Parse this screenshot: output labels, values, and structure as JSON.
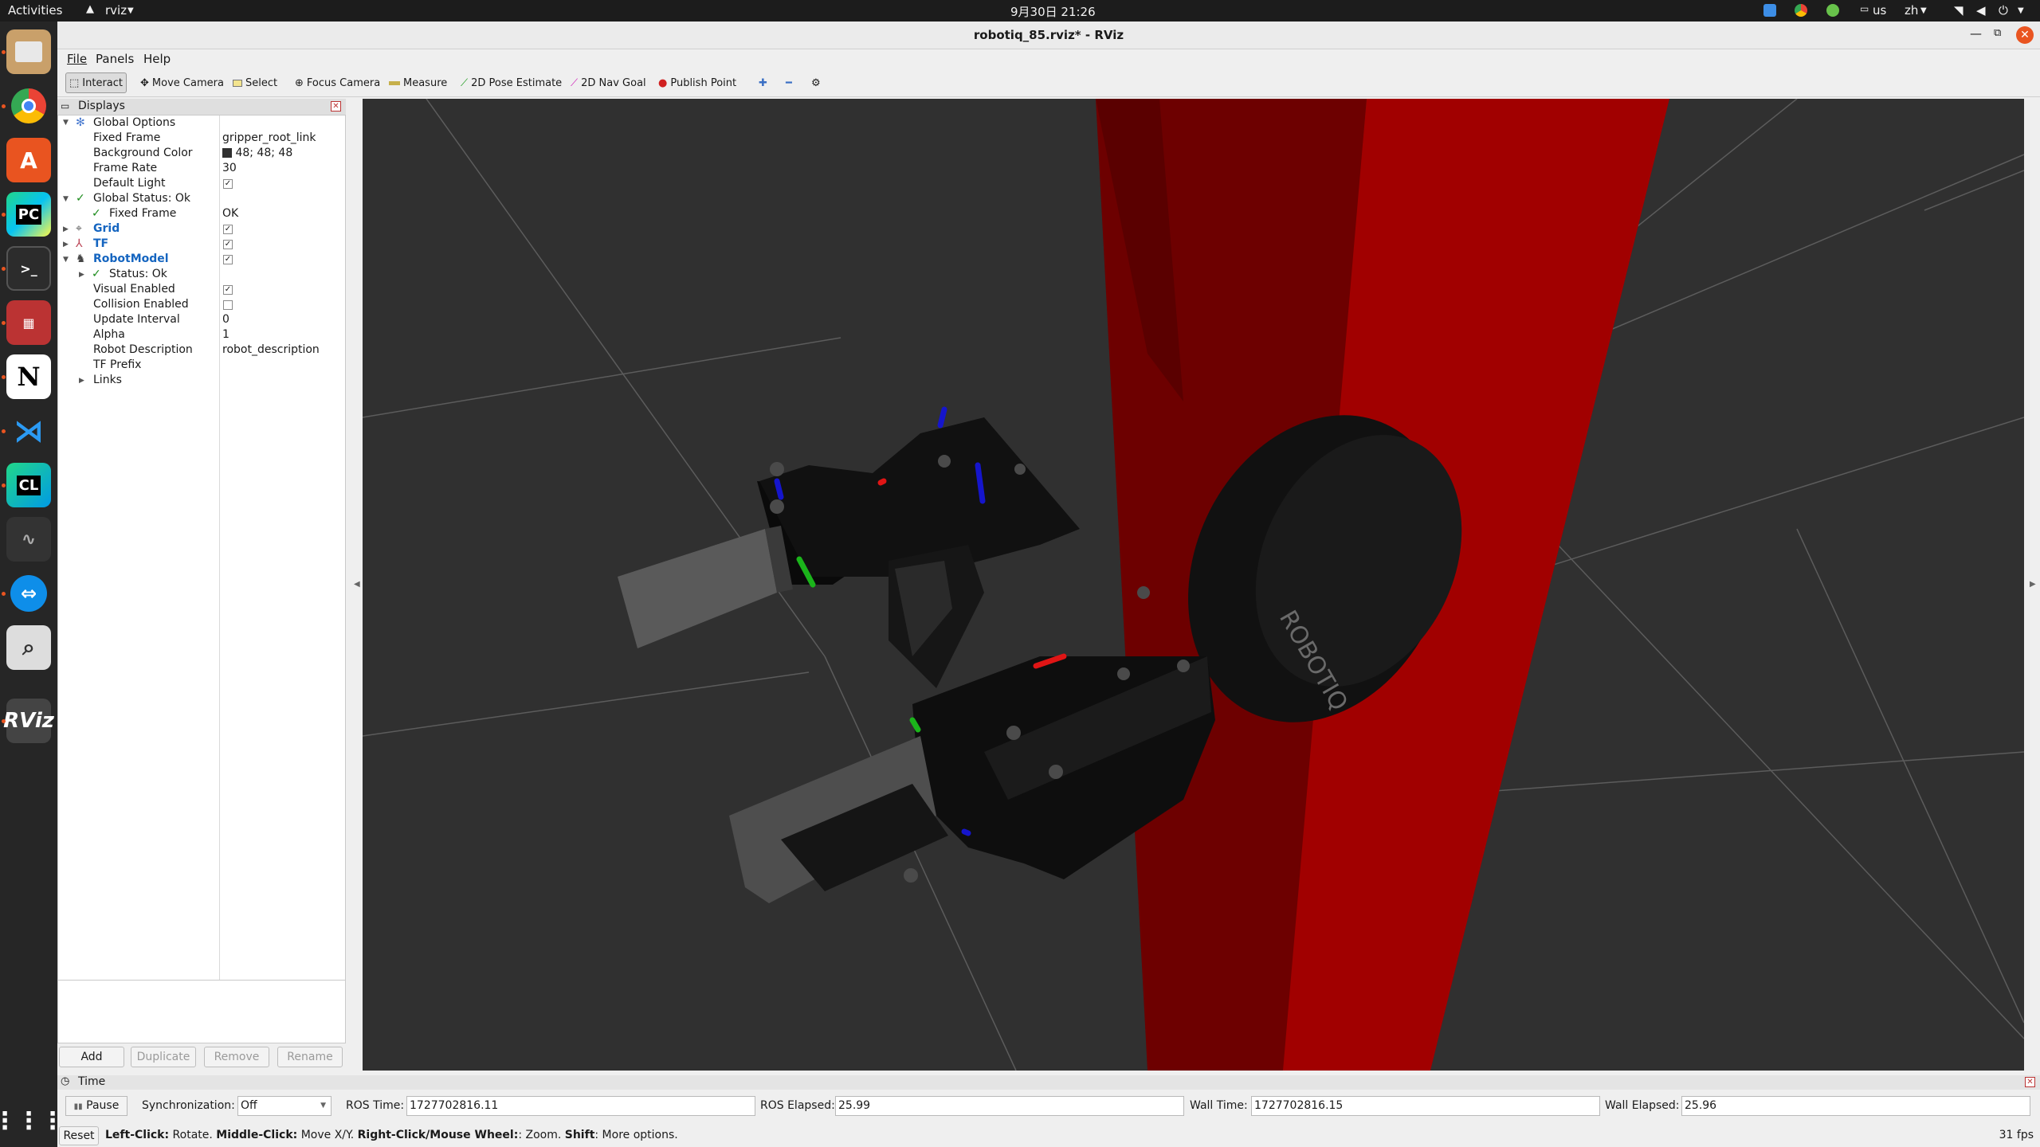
{
  "topbar": {
    "activities": "Activities",
    "app_name": "rviz",
    "clock": "9月30日  21:26",
    "keyboard": "us",
    "input_method": "zh"
  },
  "window": {
    "title": "robotiq_85.rviz* - RViz"
  },
  "menu": [
    "File",
    "Panels",
    "Help"
  ],
  "toolbar": {
    "interact": "Interact",
    "move_camera": "Move Camera",
    "select": "Select",
    "focus_camera": "Focus Camera",
    "measure": "Measure",
    "pose_estimate": "2D Pose Estimate",
    "nav_goal": "2D Nav Goal",
    "publish_point": "Publish Point"
  },
  "displays": {
    "title": "Displays",
    "global_options": "Global Options",
    "fixed_frame_label": "Fixed Frame",
    "fixed_frame_value": "gripper_root_link",
    "bg_color_label": "Background Color",
    "bg_color_value": "48; 48; 48",
    "frame_rate_label": "Frame Rate",
    "frame_rate_value": "30",
    "default_light_label": "Default Light",
    "global_status": "Global Status: Ok",
    "status_fixed_frame_label": "Fixed Frame",
    "status_fixed_frame_value": "OK",
    "grid": "Grid",
    "tf": "TF",
    "robot_model": "RobotModel",
    "status_ok": "Status: Ok",
    "visual_enabled_label": "Visual Enabled",
    "collision_enabled_label": "Collision Enabled",
    "update_interval_label": "Update Interval",
    "update_interval_value": "0",
    "alpha_label": "Alpha",
    "alpha_value": "1",
    "robot_description_label": "Robot Description",
    "robot_description_value": "robot_description",
    "tf_prefix_label": "TF Prefix",
    "links_label": "Links"
  },
  "panel_buttons": {
    "add": "Add",
    "duplicate": "Duplicate",
    "remove": "Remove",
    "rename": "Rename"
  },
  "time_panel": {
    "title": "Time",
    "pause": "Pause",
    "sync_label": "Synchronization:",
    "sync_value": "Off",
    "ros_time_label": "ROS Time:",
    "ros_time_value": "1727702816.11",
    "ros_elapsed_label": "ROS Elapsed:",
    "ros_elapsed_value": "25.99",
    "wall_time_label": "Wall Time:",
    "wall_time_value": "1727702816.15",
    "wall_elapsed_label": "Wall Elapsed:",
    "wall_elapsed_value": "25.96"
  },
  "status": {
    "reset": "Reset",
    "k1": "Left-Click:",
    "t1": " Rotate. ",
    "k2": "Middle-Click:",
    "t2": " Move X/Y. ",
    "k3": "Right-Click/Mouse Wheel:",
    "t3": ": Zoom. ",
    "k4": "Shift",
    "t4": ": More options.",
    "fps": "31 fps"
  },
  "viewport": {
    "logo_text": "ROBOTIQ"
  },
  "colors": {
    "background": "#303030",
    "accent_blue": "#1565c0",
    "red_plane": "#a10000",
    "dark_red_plane": "#6d0000"
  }
}
